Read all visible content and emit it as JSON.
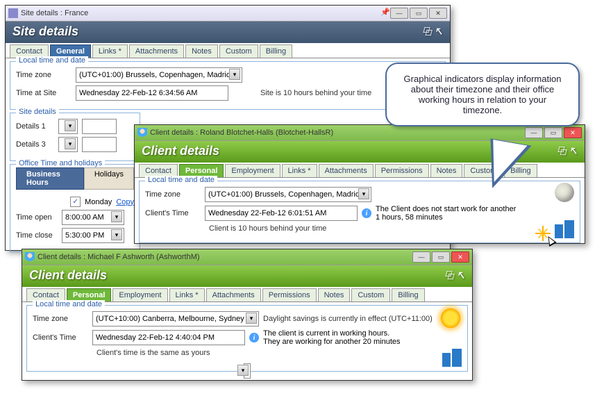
{
  "callout": "Graphical indicators display information about their timezone and their office working hours in relation to your timezone.",
  "site": {
    "titlebar": "Site  details : France",
    "header": "Site details",
    "tabs": [
      "Contact",
      "General",
      "Links *",
      "Attachments",
      "Notes",
      "Custom",
      "Billing"
    ],
    "group_time": "Local time and date",
    "tz_label": "Time zone",
    "tz_value": "(UTC+01:00) Brussels, Copenhagen, Madrid",
    "timeat_label": "Time at Site",
    "timeat_value": "Wednesday 22-Feb-12 6:34:56 AM",
    "behind": "Site is 10 hours behind your time",
    "group_details": "Site details",
    "details1": "Details 1",
    "details3": "Details 3",
    "group_office": "Office Time and holidays",
    "subtabs": [
      "Business Hours",
      "Holidays"
    ],
    "monday": "Monday",
    "copy": "Copy",
    "timeopen_label": "Time open",
    "timeopen_value": "8:00:00 AM",
    "timeclose_label": "Time close",
    "timeclose_value": "5:30:00 PM"
  },
  "client1": {
    "titlebar": "Client details : Roland Blotchet-Halls  (Blotchet-HallsR)",
    "header": "Client details",
    "tabs": [
      "Contact",
      "Personal",
      "Employment",
      "Links *",
      "Attachments",
      "Permissions",
      "Notes",
      "Custom",
      "Billing"
    ],
    "group_time": "Local time and date",
    "tz_label": "Time zone",
    "tz_value": "(UTC+01:00) Brussels, Copenhagen, Madrid",
    "ct_label": "Client's Time",
    "ct_value": "Wednesday 22-Feb-12 6:01:51 AM",
    "behind": "Client is 10 hours behind your time",
    "info1": "The Client does not start work for another",
    "info2": "1 hours, 58 minutes"
  },
  "client2": {
    "titlebar": "Client details : Michael F Ashworth  (AshworthM)",
    "header": "Client details",
    "tabs": [
      "Contact",
      "Personal",
      "Employment",
      "Links *",
      "Attachments",
      "Permissions",
      "Notes",
      "Custom",
      "Billing"
    ],
    "group_time": "Local time and date",
    "tz_label": "Time zone",
    "tz_value": "(UTC+10:00) Canberra, Melbourne, Sydney",
    "daylight": "Daylight savings is currently in effect (UTC+11:00)",
    "ct_label": "Client's Time",
    "ct_value": "Wednesday 22-Feb-12 4:40:04 PM",
    "same": "Client's time is the same as yours",
    "info1": "The client is current in working hours.",
    "info2": "They are working for another 20 minutes"
  }
}
